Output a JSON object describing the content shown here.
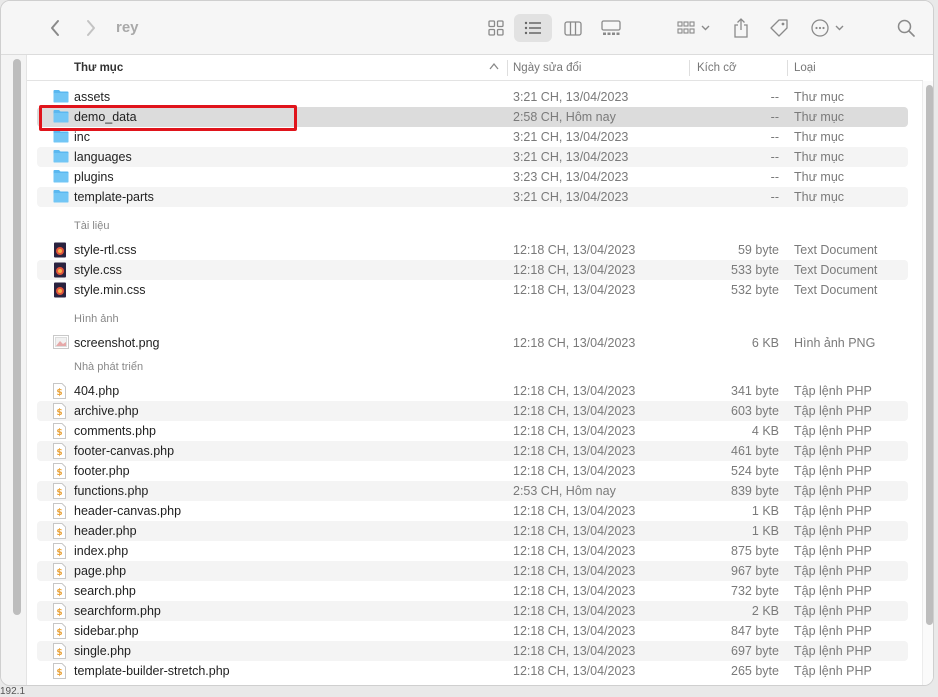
{
  "window": {
    "title": "rey",
    "status_fragment": "192.1"
  },
  "header": {
    "name": "Thư mục",
    "date": "Ngày sửa đổi",
    "size": "Kích cỡ",
    "kind": "Loại"
  },
  "groups": {
    "documents": "Tài liệu",
    "images": "Hình ảnh",
    "developer": "Nhà phát triển"
  },
  "folders": [
    {
      "name": "assets",
      "date": "3:21 CH, 13/04/2023",
      "size": "--",
      "kind": "Thư mục"
    },
    {
      "name": "demo_data",
      "date": "2:58 CH, Hôm nay",
      "size": "--",
      "kind": "Thư mục"
    },
    {
      "name": "inc",
      "date": "3:21 CH, 13/04/2023",
      "size": "--",
      "kind": "Thư mục"
    },
    {
      "name": "languages",
      "date": "3:21 CH, 13/04/2023",
      "size": "--",
      "kind": "Thư mục"
    },
    {
      "name": "plugins",
      "date": "3:23 CH, 13/04/2023",
      "size": "--",
      "kind": "Thư mục"
    },
    {
      "name": "template-parts",
      "date": "3:21 CH, 13/04/2023",
      "size": "--",
      "kind": "Thư mục"
    }
  ],
  "documents": [
    {
      "name": "style-rtl.css",
      "date": "12:18 CH, 13/04/2023",
      "size": "59 byte",
      "kind": "Text Document"
    },
    {
      "name": "style.css",
      "date": "12:18 CH, 13/04/2023",
      "size": "533 byte",
      "kind": "Text Document"
    },
    {
      "name": "style.min.css",
      "date": "12:18 CH, 13/04/2023",
      "size": "532 byte",
      "kind": "Text Document"
    }
  ],
  "images": [
    {
      "name": "screenshot.png",
      "date": "12:18 CH, 13/04/2023",
      "size": "6 KB",
      "kind": "Hình ảnh PNG"
    }
  ],
  "developer": [
    {
      "name": "404.php",
      "date": "12:18 CH, 13/04/2023",
      "size": "341 byte",
      "kind": "Tập lệnh PHP"
    },
    {
      "name": "archive.php",
      "date": "12:18 CH, 13/04/2023",
      "size": "603 byte",
      "kind": "Tập lệnh PHP"
    },
    {
      "name": "comments.php",
      "date": "12:18 CH, 13/04/2023",
      "size": "4 KB",
      "kind": "Tập lệnh PHP"
    },
    {
      "name": "footer-canvas.php",
      "date": "12:18 CH, 13/04/2023",
      "size": "461 byte",
      "kind": "Tập lệnh PHP"
    },
    {
      "name": "footer.php",
      "date": "12:18 CH, 13/04/2023",
      "size": "524 byte",
      "kind": "Tập lệnh PHP"
    },
    {
      "name": "functions.php",
      "date": "2:53 CH, Hôm nay",
      "size": "839 byte",
      "kind": "Tập lệnh PHP"
    },
    {
      "name": "header-canvas.php",
      "date": "12:18 CH, 13/04/2023",
      "size": "1 KB",
      "kind": "Tập lệnh PHP"
    },
    {
      "name": "header.php",
      "date": "12:18 CH, 13/04/2023",
      "size": "1 KB",
      "kind": "Tập lệnh PHP"
    },
    {
      "name": "index.php",
      "date": "12:18 CH, 13/04/2023",
      "size": "875 byte",
      "kind": "Tập lệnh PHP"
    },
    {
      "name": "page.php",
      "date": "12:18 CH, 13/04/2023",
      "size": "967 byte",
      "kind": "Tập lệnh PHP"
    },
    {
      "name": "search.php",
      "date": "12:18 CH, 13/04/2023",
      "size": "732 byte",
      "kind": "Tập lệnh PHP"
    },
    {
      "name": "searchform.php",
      "date": "12:18 CH, 13/04/2023",
      "size": "2 KB",
      "kind": "Tập lệnh PHP"
    },
    {
      "name": "sidebar.php",
      "date": "12:18 CH, 13/04/2023",
      "size": "847 byte",
      "kind": "Tập lệnh PHP"
    },
    {
      "name": "single.php",
      "date": "12:18 CH, 13/04/2023",
      "size": "697 byte",
      "kind": "Tập lệnh PHP"
    },
    {
      "name": "template-builder-stretch.php",
      "date": "12:18 CH, 13/04/2023",
      "size": "265 byte",
      "kind": "Tập lệnh PHP"
    }
  ],
  "colors": {
    "folder": "#5ab8f0",
    "highlight": "#e0141b",
    "php_accent": "#e8a23a"
  },
  "icons": {
    "back": "chevron-left-icon",
    "forward": "chevron-right-icon",
    "views": [
      "icon-grid-view-icon",
      "list-view-icon",
      "column-view-icon",
      "gallery-view-icon"
    ],
    "group": "group-by-icon",
    "share": "share-icon",
    "tag": "tag-icon",
    "more": "more-options-icon",
    "search": "search-icon"
  }
}
